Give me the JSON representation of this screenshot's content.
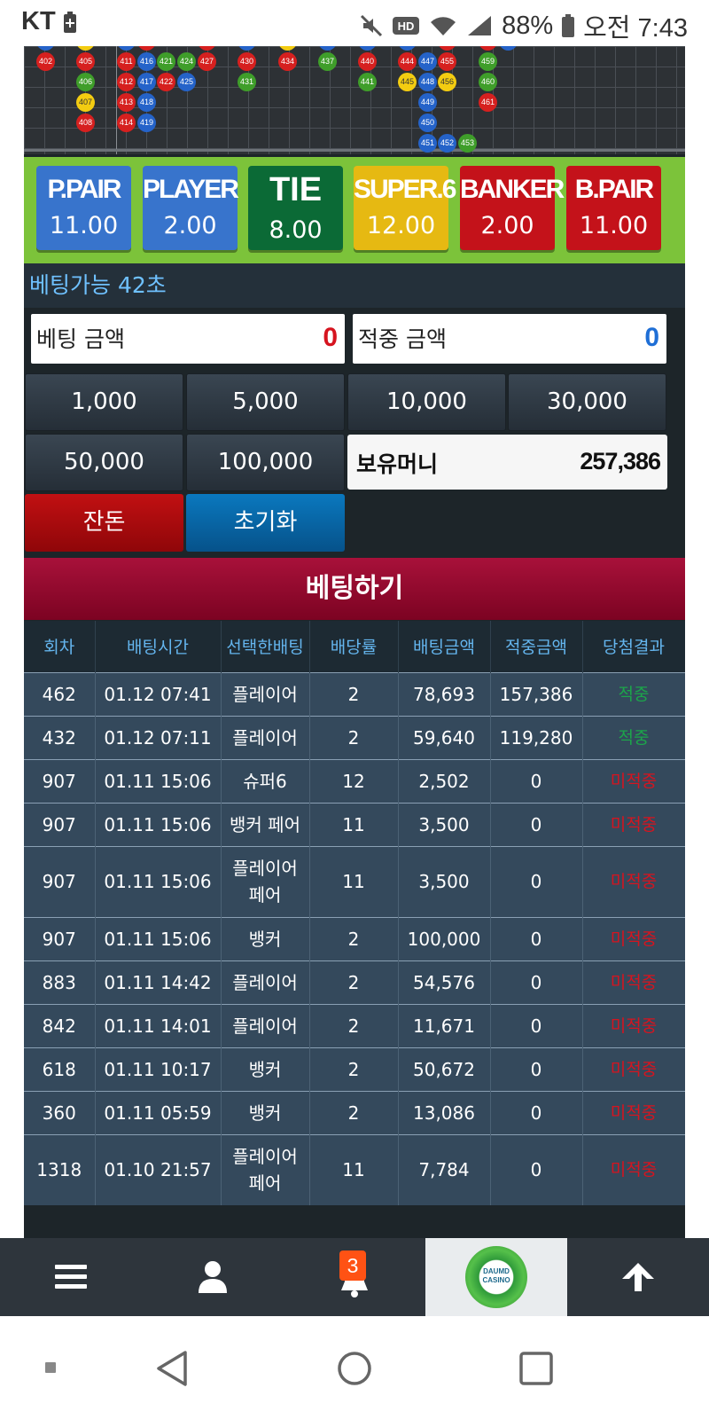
{
  "status_bar": {
    "carrier": "KT",
    "battery": "88%",
    "time": "오전 7:43"
  },
  "roadmap": {
    "beads": [
      {
        "n": "402",
        "c": "r"
      },
      {
        "n": "405",
        "c": "r"
      },
      {
        "n": "406",
        "c": "g"
      },
      {
        "n": "407",
        "c": "y"
      },
      {
        "n": "408",
        "c": "r"
      },
      {
        "n": "411",
        "c": "r"
      },
      {
        "n": "412",
        "c": "r"
      },
      {
        "n": "413",
        "c": "r"
      },
      {
        "n": "414",
        "c": "r"
      },
      {
        "n": "416",
        "c": "b"
      },
      {
        "n": "417",
        "c": "b"
      },
      {
        "n": "418",
        "c": "b"
      },
      {
        "n": "419",
        "c": "b"
      },
      {
        "n": "421",
        "c": "g"
      },
      {
        "n": "422",
        "c": "r"
      },
      {
        "n": "424",
        "c": "g"
      },
      {
        "n": "425",
        "c": "b"
      },
      {
        "n": "427",
        "c": "r"
      },
      {
        "n": "430",
        "c": "r"
      },
      {
        "n": "431",
        "c": "g"
      },
      {
        "n": "434",
        "c": "r"
      },
      {
        "n": "437",
        "c": "g"
      },
      {
        "n": "440",
        "c": "r"
      },
      {
        "n": "441",
        "c": "g"
      },
      {
        "n": "444",
        "c": "r"
      },
      {
        "n": "445",
        "c": "y"
      },
      {
        "n": "447",
        "c": "b"
      },
      {
        "n": "448",
        "c": "b"
      },
      {
        "n": "449",
        "c": "b"
      },
      {
        "n": "450",
        "c": "b"
      },
      {
        "n": "451",
        "c": "b"
      },
      {
        "n": "452",
        "c": "b"
      },
      {
        "n": "453",
        "c": "g"
      },
      {
        "n": "455",
        "c": "r"
      },
      {
        "n": "456",
        "c": "y"
      },
      {
        "n": "459",
        "c": "g"
      },
      {
        "n": "460",
        "c": "g"
      },
      {
        "n": "461",
        "c": "r"
      }
    ]
  },
  "bet_options": [
    {
      "label": "P.PAIR",
      "odds": "11.00",
      "color": "#3874cc"
    },
    {
      "label": "PLAYER",
      "odds": "2.00",
      "color": "#3874cc"
    },
    {
      "label": "TIE",
      "odds": "8.00",
      "color": "#0b6a36"
    },
    {
      "label": "SUPER.6",
      "odds": "12.00",
      "color": "#e6b912"
    },
    {
      "label": "BANKER",
      "odds": "2.00",
      "color": "#c4121a"
    },
    {
      "label": "B.PAIR",
      "odds": "11.00",
      "color": "#c4121a"
    }
  ],
  "bet_status": "베팅가능 42초",
  "bet_amount": {
    "label": "베팅 금액",
    "value": "0"
  },
  "win_amount": {
    "label": "적중 금액",
    "value": "0"
  },
  "chips": [
    "1,000",
    "5,000",
    "10,000",
    "30,000",
    "50,000",
    "100,000"
  ],
  "balance": {
    "label": "보유머니",
    "value": "257,386"
  },
  "buttons": {
    "change": "잔돈",
    "reset": "초기화",
    "place_bet": "베팅하기"
  },
  "history": {
    "headers": [
      "회차",
      "배팅시간",
      "선택한배팅",
      "배당률",
      "배팅금액",
      "적중금액",
      "당첨결과"
    ],
    "rows": [
      {
        "round": "462",
        "time": "01.12 07:41",
        "choice": "플레이어",
        "odds": "2",
        "amount": "78,693",
        "payout": "157,386",
        "result": "적중"
      },
      {
        "round": "432",
        "time": "01.12 07:11",
        "choice": "플레이어",
        "odds": "2",
        "amount": "59,640",
        "payout": "119,280",
        "result": "적중"
      },
      {
        "round": "907",
        "time": "01.11 15:06",
        "choice": "슈퍼6",
        "odds": "12",
        "amount": "2,502",
        "payout": "0",
        "result": "미적중"
      },
      {
        "round": "907",
        "time": "01.11 15:06",
        "choice": "뱅커 페어",
        "odds": "11",
        "amount": "3,500",
        "payout": "0",
        "result": "미적중"
      },
      {
        "round": "907",
        "time": "01.11 15:06",
        "choice": "플레이어 페어",
        "odds": "11",
        "amount": "3,500",
        "payout": "0",
        "result": "미적중"
      },
      {
        "round": "907",
        "time": "01.11 15:06",
        "choice": "뱅커",
        "odds": "2",
        "amount": "100,000",
        "payout": "0",
        "result": "미적중"
      },
      {
        "round": "883",
        "time": "01.11 14:42",
        "choice": "플레이어",
        "odds": "2",
        "amount": "54,576",
        "payout": "0",
        "result": "미적중"
      },
      {
        "round": "842",
        "time": "01.11 14:01",
        "choice": "플레이어",
        "odds": "2",
        "amount": "11,671",
        "payout": "0",
        "result": "미적중"
      },
      {
        "round": "618",
        "time": "01.11 10:17",
        "choice": "뱅커",
        "odds": "2",
        "amount": "50,672",
        "payout": "0",
        "result": "미적중"
      },
      {
        "round": "360",
        "time": "01.11 05:59",
        "choice": "뱅커",
        "odds": "2",
        "amount": "13,086",
        "payout": "0",
        "result": "미적중"
      },
      {
        "round": "1318",
        "time": "01.10 21:57",
        "choice": "플레이어 페어",
        "odds": "11",
        "amount": "7,784",
        "payout": "0",
        "result": "미적중"
      }
    ]
  },
  "bottom_nav": {
    "items": [
      {
        "icon": "menu-icon"
      },
      {
        "icon": "user-icon"
      },
      {
        "icon": "bell-icon",
        "badge": "3"
      },
      {
        "icon": "logo"
      },
      {
        "icon": "arrow-up-icon"
      }
    ],
    "logo_line1": "DAUMD",
    "logo_line2": "CASINO"
  },
  "colors": {
    "win": "#1ca54a",
    "lose": "#d6141f",
    "bet_amount_value": "#d6141f",
    "win_amount_value": "#1f6fd6",
    "accent_header": "#64b5ee"
  }
}
